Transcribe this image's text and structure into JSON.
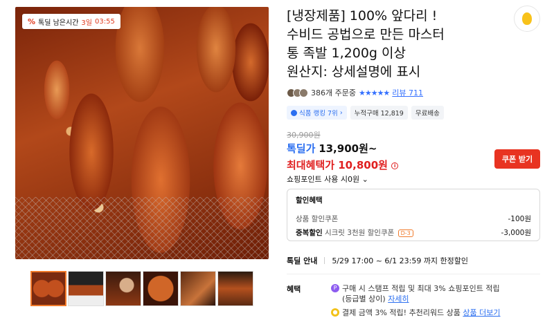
{
  "timer": {
    "label": "톡딜 남은시간",
    "days": "3일",
    "time": "03:55"
  },
  "product": {
    "title_line1": "[냉장제품] 100% 앞다리 !",
    "title_line2": "수비드 공법으로 만든 마스터",
    "title_line3": "통 족발 1,200g 이상",
    "title_line4": "원산지: 상세설명에 표시"
  },
  "rating": {
    "orders": "386개 주문중",
    "stars": "★★★★★",
    "review": "리뷰 711"
  },
  "tags": {
    "rank": "식품 랭킹 7위",
    "cumulative": "누적구매 12,819",
    "shipping": "무료배송"
  },
  "price": {
    "original": "30,900원",
    "deal_label": "톡딜가",
    "deal_value": "13,900원~",
    "max_label": "최대혜택가",
    "max_value": "10,800원",
    "coupon_button": "쿠폰 받기",
    "points": "쇼핑포인트 사용 시0원"
  },
  "discount": {
    "title": "할인혜택",
    "row1_label": "상품 할인쿠폰",
    "row1_amount": "-100원",
    "row2_bold": "중복할인",
    "row2_label": "시크릿 3천원 할인쿠폰",
    "row2_badge": "D-3",
    "row2_amount": "-3,000원"
  },
  "deal_info": {
    "label": "톡딜 안내",
    "period": "5/29 17:00 ~ 6/1 23:59 까지 한정할인"
  },
  "benefits": {
    "label": "혜택",
    "b1_text": "구매 시 스탬프 적립 및 최대 3% 쇼핑포인트 적립",
    "b1_text2": "(등급별 상이)",
    "b1_link": "자세히",
    "b2_text": "결제 금액 3% 적립! 추천리워드 상품",
    "b2_link": "상품 더보기"
  }
}
